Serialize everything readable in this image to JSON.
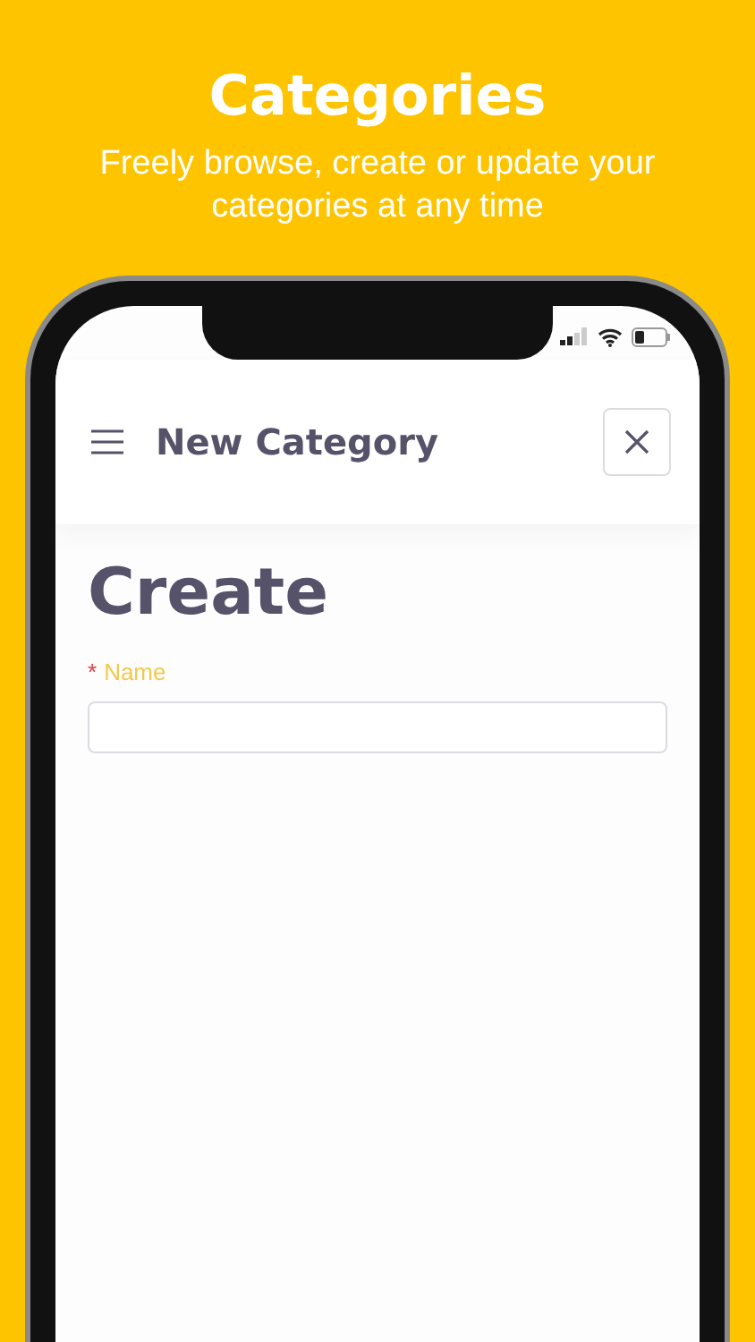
{
  "promo": {
    "title": "Categories",
    "subtitle": "Freely browse, create or update your categories at any time"
  },
  "app_bar": {
    "title": "New Category"
  },
  "form": {
    "heading": "Create",
    "fields": [
      {
        "required_mark": "*",
        "label": "Name"
      }
    ]
  }
}
